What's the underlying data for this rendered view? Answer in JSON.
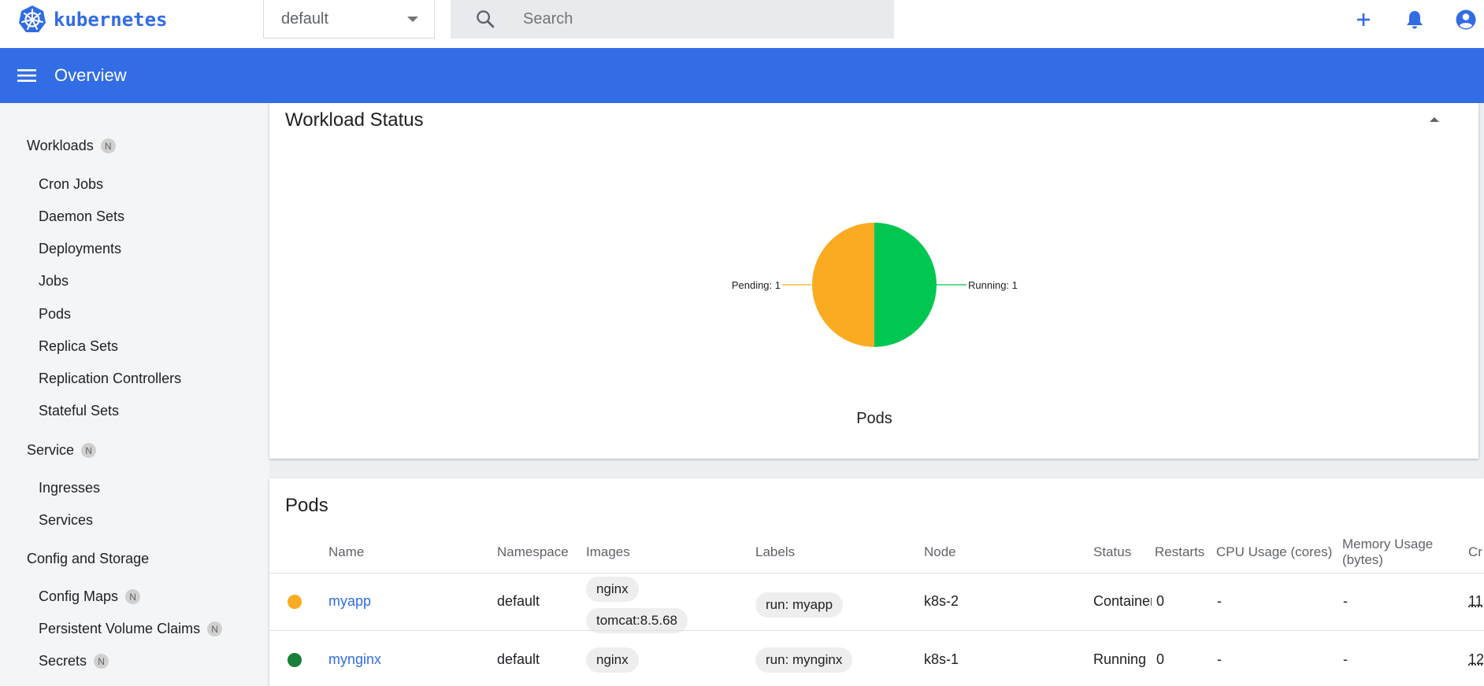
{
  "app": {
    "logo_text": "kubernetes"
  },
  "namespace_select": {
    "value": "default"
  },
  "search": {
    "placeholder": "Search"
  },
  "header": {
    "title": "Overview"
  },
  "sidebar": {
    "sections": [
      {
        "label": "Workloads",
        "badge": "N"
      },
      {
        "label": "Service",
        "badge": "N"
      },
      {
        "label": "Config and Storage"
      }
    ],
    "workloads": [
      "Cron Jobs",
      "Daemon Sets",
      "Deployments",
      "Jobs",
      "Pods",
      "Replica Sets",
      "Replication Controllers",
      "Stateful Sets"
    ],
    "service": [
      "Ingresses",
      "Services"
    ],
    "config": [
      {
        "label": "Config Maps",
        "badge": "N"
      },
      {
        "label": "Persistent Volume Claims",
        "badge": "N"
      },
      {
        "label": "Secrets",
        "badge": "N"
      }
    ]
  },
  "workload_status": {
    "title": "Workload Status",
    "pie_label_pending": "Pending: 1",
    "pie_label_running": "Running: 1",
    "pie_caption": "Pods"
  },
  "chart_data": {
    "type": "pie",
    "title": "Pods",
    "slices": [
      {
        "label": "Pending",
        "value": 1,
        "color": "#faab21"
      },
      {
        "label": "Running",
        "value": 1,
        "color": "#00c752"
      }
    ]
  },
  "pods": {
    "title": "Pods",
    "columns": [
      "Name",
      "Namespace",
      "Images",
      "Labels",
      "Node",
      "Status",
      "Restarts",
      "CPU Usage (cores)",
      "Memory Usage (bytes)",
      "Cr"
    ],
    "rows": [
      {
        "status_color": "#faab21",
        "name": "myapp",
        "namespace": "default",
        "images": [
          "nginx",
          "tomcat:8.5.68"
        ],
        "labels": [
          "run: myapp"
        ],
        "node": "k8s-2",
        "status": "Container",
        "restarts": "0",
        "cpu": "-",
        "memory": "-",
        "created": "11"
      },
      {
        "status_color": "#188038",
        "name": "mynginx",
        "namespace": "default",
        "images": [
          "nginx"
        ],
        "labels": [
          "run: mynginx"
        ],
        "node": "k8s-1",
        "status": "Running",
        "restarts": "0",
        "cpu": "-",
        "memory": "-",
        "created": "12"
      }
    ]
  },
  "colors": {
    "brand": "#326ce5",
    "header": "#326de6",
    "pending": "#faab21",
    "running": "#00c752"
  }
}
